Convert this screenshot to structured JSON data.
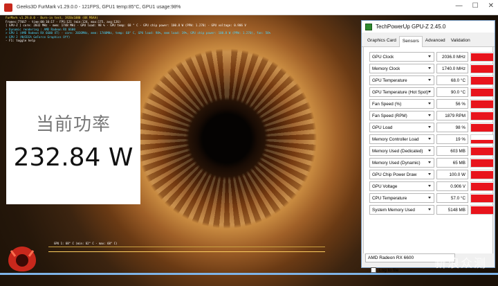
{
  "furmark": {
    "title": "Geeks3D FurMark v1.29.0.0 - 121FPS, GPU1 temp:85°C, GPU1 usage:98%",
    "osd_lines": [
      {
        "text": "FurMark v1.29.0.0 - Burn-in test, 1920x1080 (0X MSAA)",
        "color": "yellow"
      },
      {
        "text": "Frames:77667 - time:00:10:17 - FPS:121 (min:124, max:175, avg:126)",
        "color": "white"
      },
      {
        "text": "[ GPU-Z ] core: 2032 MHz - mem: 1748 MHz - GPU load: 98 % - GPU temp: 68 ° C - GPU chip power: 100.8 W (PPW: 1.270) - GPU voltage: 0.906 V",
        "color": "white"
      },
      {
        "text": "> Dynamic rendering : AMD Radeon RX 6600",
        "color": "cyan"
      },
      {
        "text": "> GPU 1 (AMD Radeon RX 6600 XT) - core: 2036MHz, mem: 1740MHz, temp: 68° C, GPU load: 98%, mem load: 19%, GPU chip power: 100.8 W (PPW: 1.270), fan: 56%",
        "color": "cyan"
      },
      {
        "text": "> GPU 2 (NVIDIA GeForce Graphics Off)",
        "color": "cyan"
      },
      {
        "text": "- F1: toggle help",
        "color": "white"
      }
    ],
    "graph_label": "GPU 1: 68° C (min: 62° C - max: 68° C)"
  },
  "power_panel": {
    "label": "当前功率",
    "value": "232.84 W"
  },
  "gpuz": {
    "title": "TechPowerUp GPU-Z 2.45.0",
    "tabs": [
      "Graphics Card",
      "Sensors",
      "Advanced",
      "Validation"
    ],
    "active_tab": "Sensors",
    "sensors": [
      {
        "name": "GPU Clock",
        "value": "2036.0 MHz",
        "fill": 0.95
      },
      {
        "name": "Memory Clock",
        "value": "1740.0 MHz",
        "fill": 0.95
      },
      {
        "name": "GPU Temperature",
        "value": "68.0 °C",
        "fill": 0.9
      },
      {
        "name": "GPU Temperature (Hot Spot)",
        "value": "90.0 °C",
        "fill": 0.9
      },
      {
        "name": "Fan Speed (%)",
        "value": "56 %",
        "fill": 0.9
      },
      {
        "name": "Fan Speed (RPM)",
        "value": "1879 RPM",
        "fill": 0.9
      },
      {
        "name": "GPU Load",
        "value": "98 %",
        "fill": 0.95
      },
      {
        "name": "Memory Controller Load",
        "value": "19 %",
        "fill": 0.45
      },
      {
        "name": "Memory Used (Dedicated)",
        "value": "603 MB",
        "fill": 0.9
      },
      {
        "name": "Memory Used (Dynamic)",
        "value": "65 MB",
        "fill": 0.9
      },
      {
        "name": "GPU Chip Power Draw",
        "value": "100.0 W",
        "fill": 0.9
      },
      {
        "name": "GPU Voltage",
        "value": "0.906 V",
        "fill": 0.9
      },
      {
        "name": "CPU Temperature",
        "value": "57.0 °C",
        "fill": 0.9
      },
      {
        "name": "System Memory Used",
        "value": "5148 MB",
        "fill": 0.9
      }
    ],
    "log_label": "Log to file",
    "device": "AMD Radeon RX 6600"
  },
  "watermark": "新浪众测",
  "colors": {
    "bar": "#e8141c",
    "osd_yellow": "#ffe44a",
    "osd_cyan": "#4ad8ff"
  }
}
